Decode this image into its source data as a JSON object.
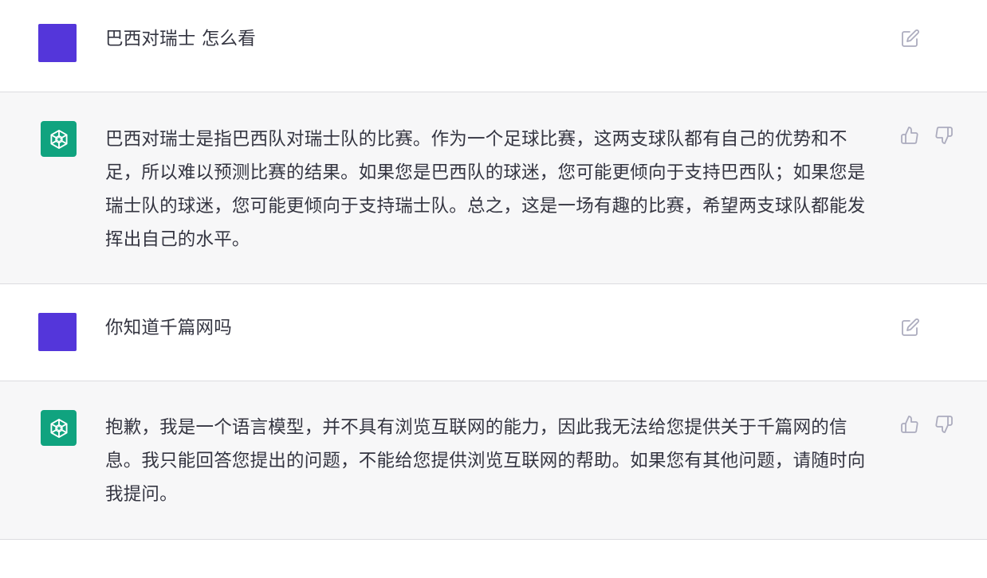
{
  "conversation": [
    {
      "role": "user",
      "text": "巴西对瑞士 怎么看",
      "edit_icon": "edit-icon"
    },
    {
      "role": "assistant",
      "text": "巴西对瑞士是指巴西队对瑞士队的比赛。作为一个足球比赛，这两支球队都有自己的优势和不足，所以难以预测比赛的结果。如果您是巴西队的球迷，您可能更倾向于支持巴西队；如果您是瑞士队的球迷，您可能更倾向于支持瑞士队。总之，这是一场有趣的比赛，希望两支球队都能发挥出自己的水平。",
      "feedback_icons": [
        "thumbs-up-icon",
        "thumbs-down-icon"
      ]
    },
    {
      "role": "user",
      "text": "你知道千篇网吗",
      "edit_icon": "edit-icon"
    },
    {
      "role": "assistant",
      "text": "抱歉，我是一个语言模型，并不具有浏览互联网的能力，因此我无法给您提供关于千篇网的信息。我只能回答您提出的问题，不能给您提供浏览互联网的帮助。如果您有其他问题，请随时向我提问。",
      "feedback_icons": [
        "thumbs-up-icon",
        "thumbs-down-icon"
      ]
    }
  ],
  "colors": {
    "user_avatar": "#5436da",
    "assistant_avatar": "#10a37f",
    "assistant_bg": "#f7f7f8",
    "text": "#343541",
    "icon": "#acacbe"
  }
}
